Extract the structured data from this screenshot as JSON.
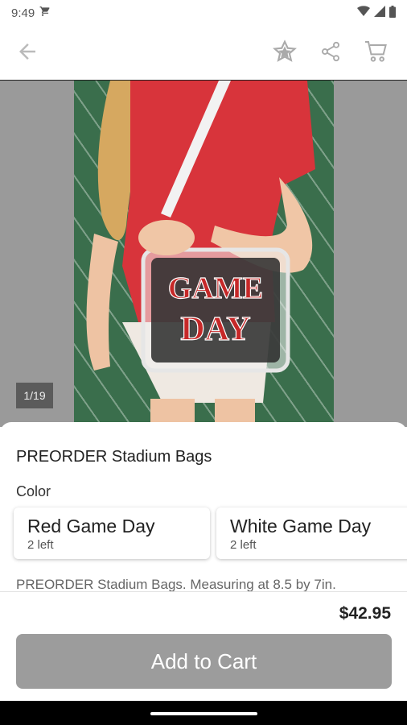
{
  "status_bar": {
    "time": "9:49"
  },
  "image": {
    "counter": "1/19",
    "bag_text_line1": "GAME",
    "bag_text_line2": "DAY"
  },
  "product": {
    "title": "PREORDER Stadium Bags",
    "color_label": "Color",
    "variants": [
      {
        "name": "Red Game Day",
        "stock": "2 left"
      },
      {
        "name": "White Game Day",
        "stock": "2 left"
      }
    ],
    "description": "PREORDER Stadium Bags. Measuring at 8.5 by 7in.",
    "price": "$42.95"
  },
  "actions": {
    "add_to_cart": "Add to Cart"
  },
  "colors": {
    "button_gray": "#9c9c9c",
    "bag_red": "#c62828",
    "jersey_red": "#d8343b",
    "field_green": "#3a6e4c"
  }
}
